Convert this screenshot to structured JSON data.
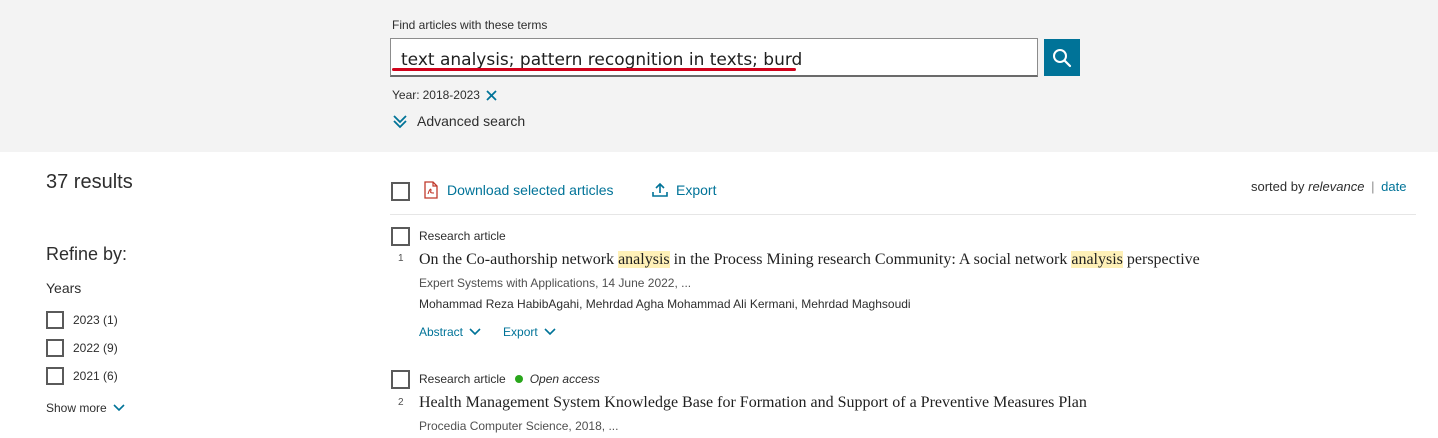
{
  "search": {
    "label": "Find articles with these terms",
    "query": "text analysis; pattern recognition in texts; burd",
    "button_icon": "search-icon",
    "year_filter_label": "Year:",
    "year_filter_value": "2018-2023",
    "advanced_label": "Advanced search"
  },
  "sidebar": {
    "results_count": "37 results",
    "refine_label": "Refine by:",
    "years_heading": "Years",
    "years": [
      {
        "label": "2023 (1)"
      },
      {
        "label": "2022 (9)"
      },
      {
        "label": "2021 (6)"
      }
    ],
    "show_more": "Show more"
  },
  "toolbar": {
    "download_label": "Download selected articles",
    "export_label": "Export",
    "sorted_prefix": "sorted by",
    "sort_relevance": "relevance",
    "sort_separator": "|",
    "sort_date": "date"
  },
  "results": [
    {
      "number": "1",
      "type": "Research article",
      "title_parts": [
        "On the Co-authorship network ",
        "analysis",
        " in the Process Mining research Community: A social network ",
        "analysis",
        " perspective"
      ],
      "source": "Expert Systems with Applications, 14 June 2022, ...",
      "authors": "Mohammad Reza HabibAgahi, Mehrdad Agha Mohammad Ali Kermani, Mehrdad Maghsoudi",
      "abstract_label": "Abstract",
      "export_label": "Export"
    },
    {
      "number": "2",
      "type": "Research article",
      "open_access": "Open access",
      "title": "Health Management System Knowledge Base for Formation and Support of a Preventive Measures Plan",
      "source": "Procedia Computer Science, 2018, ..."
    }
  ],
  "colors": {
    "accent": "#007398",
    "highlight": "#fff1b8",
    "open_access": "#29a61b",
    "annotation_underline": "#d0021b",
    "band": "#f3f3f3"
  }
}
